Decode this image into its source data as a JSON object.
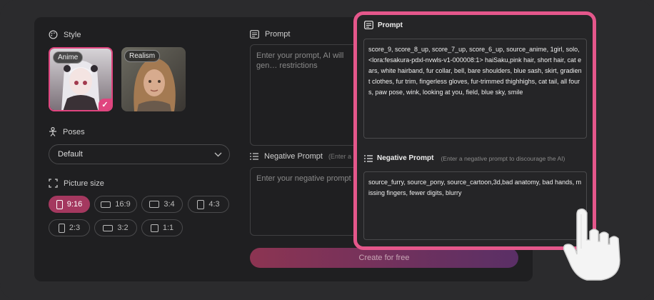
{
  "style": {
    "title": "Style",
    "options": [
      {
        "label": "Anime",
        "selected": true
      },
      {
        "label": "Realism",
        "selected": false
      }
    ]
  },
  "poses": {
    "title": "Poses",
    "value": "Default"
  },
  "picture_size": {
    "title": "Picture size",
    "ratios": [
      "9:16",
      "16:9",
      "3:4",
      "4:3",
      "2:3",
      "3:2",
      "1:1"
    ],
    "selected": "9:16"
  },
  "prompt": {
    "title": "Prompt",
    "placeholder": "Enter your prompt, AI will gen… restrictions"
  },
  "negative_prompt": {
    "title": "Negative Prompt",
    "hint": "(Enter a nega",
    "placeholder": "Enter your negative prompt"
  },
  "create_button": "Create for free",
  "overlay": {
    "prompt_title": "Prompt",
    "prompt_text": "score_9, score_8_up, score_7_up, score_6_up, source_anime, 1girl, solo, <lora:fesakura-pdxl-nvwls-v1-000008:1> haiSaku,pink hair, short hair, cat ears, white hairband, fur collar, bell, bare shoulders, blue sash, skirt, gradient clothes, fur trim, fingerless gloves, fur-trimmed thighhighs, cat tail, all fours, paw pose, wink, looking at you, field, blue sky, smile",
    "negative_title": "Negative Prompt",
    "negative_hint": "(Enter a negative prompt to discourage the AI)",
    "negative_text": "source_furry, source_pony, source_cartoon,3d,bad anatomy, bad hands, missing fingers, fewer digits, blurry"
  },
  "colors": {
    "accent": "#e4578b",
    "selected_ratio": "#a4385f",
    "panel": "#1f1f21"
  }
}
